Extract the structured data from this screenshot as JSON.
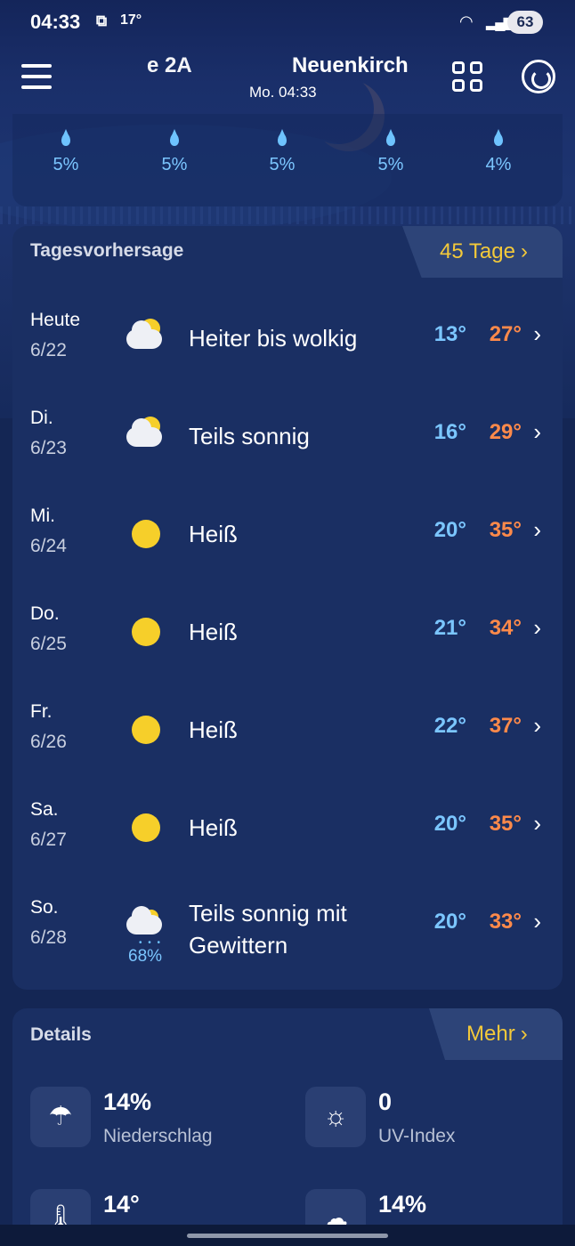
{
  "status_bar": {
    "time": "04:33",
    "extra_icon": "screenshot-icon",
    "temperature": "17°",
    "wifi_label": "5",
    "battery": "63"
  },
  "header": {
    "prev_location": "e 2A",
    "current_location": "Neuenkirch",
    "local_time": "Mo. 04:33"
  },
  "hourly_precip": {
    "values": [
      "5%",
      "5%",
      "5%",
      "5%",
      "4%"
    ]
  },
  "daily": {
    "title": "Tagesvorhersage",
    "more_label": "45 Tage",
    "days": [
      {
        "name": "Heute",
        "date": "6/22",
        "icon": "partly-cloudy-icon",
        "desc": "Heiter bis wolkig",
        "low": "13°",
        "high": "27°",
        "rain": ""
      },
      {
        "name": "Di.",
        "date": "6/23",
        "icon": "partly-cloudy-icon",
        "desc": "Teils sonnig",
        "low": "16°",
        "high": "29°",
        "rain": ""
      },
      {
        "name": "Mi.",
        "date": "6/24",
        "icon": "sun-icon",
        "desc": "Heiß",
        "low": "20°",
        "high": "35°",
        "rain": ""
      },
      {
        "name": "Do.",
        "date": "6/25",
        "icon": "sun-icon",
        "desc": "Heiß",
        "low": "21°",
        "high": "34°",
        "rain": ""
      },
      {
        "name": "Fr.",
        "date": "6/26",
        "icon": "sun-icon",
        "desc": "Heiß",
        "low": "22°",
        "high": "37°",
        "rain": ""
      },
      {
        "name": "Sa.",
        "date": "6/27",
        "icon": "sun-icon",
        "desc": "Heiß",
        "low": "20°",
        "high": "35°",
        "rain": ""
      },
      {
        "name": "So.",
        "date": "6/28",
        "icon": "thunderstorm-icon",
        "desc": "Teils sonnig mit Gewittern",
        "low": "20°",
        "high": "33°",
        "rain": "68%"
      }
    ]
  },
  "details": {
    "title": "Details",
    "more_label": "Mehr",
    "items": [
      {
        "icon": "umbrella-icon",
        "value": "14%",
        "label": "Niederschlag"
      },
      {
        "icon": "uv-sun-icon",
        "value": "0",
        "label": "UV-Index"
      },
      {
        "icon": "thermometer-icon",
        "value": "14°",
        "label": ""
      },
      {
        "icon": "cloud-icon",
        "value": "14%",
        "label": ""
      }
    ]
  },
  "colors": {
    "background": "#142654",
    "card": "#1a2f63",
    "accent_yellow": "#f3c93a",
    "temp_low": "#7bc6ff",
    "temp_high": "#ff8a4a"
  }
}
